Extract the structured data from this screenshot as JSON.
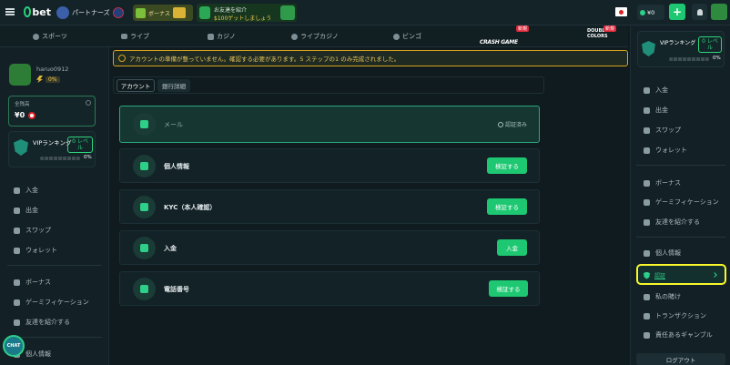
{
  "header": {
    "logo": "bet",
    "partners": "パートナーズ",
    "bonus": "ボーナス",
    "promo_line1": "お友達を紹介",
    "promo_line2": "$100ゲットしましょう",
    "balance": "¥0",
    "add": "+"
  },
  "nav": {
    "items": [
      "スポーツ",
      "ライブ",
      "カジノ",
      "ライブカジノ",
      "ビンゴ"
    ],
    "crash": "CRASH GAME",
    "double": "DOUBLE COLORS",
    "new_badge": "新規"
  },
  "user": {
    "name": "haruo0912",
    "percent": "0%"
  },
  "wallet": {
    "label": "全残高",
    "amount": "¥0"
  },
  "vip": {
    "title": "VIPランキング",
    "level": "0 レベル",
    "percent": "0%"
  },
  "left_menu": {
    "deposit": "入金",
    "withdraw": "出金",
    "swap": "スワップ",
    "wallet": "ウォレット",
    "bonus": "ボーナス",
    "gamification": "ゲーミフィケーション",
    "referral": "友達を紹介する",
    "personal": "個人情報",
    "chat": "CHAT"
  },
  "alert": "アカウントの準備が整っていません。確認する必要があります。5 ステップの1 のみ完成されました。",
  "tabs": {
    "account": "アカウント",
    "bank": "銀行詳細"
  },
  "verify": {
    "email": {
      "label": "メール",
      "status": "認証済み"
    },
    "personal": {
      "label": "個人情報",
      "button": "検証する"
    },
    "kyc": {
      "label": "KYC（本人確認）",
      "button": "検証する"
    },
    "deposit": {
      "label": "入金",
      "button": "入金"
    },
    "phone": {
      "label": "電話番号",
      "button": "検証する"
    }
  },
  "right_menu": {
    "vip_title": "VIPランキング",
    "vip_level": "0 レベル",
    "percent": "0%",
    "deposit": "入金",
    "withdraw": "出金",
    "swap": "スワップ",
    "wallet": "ウォレット",
    "bonus": "ボーナス",
    "gamification": "ゲーミフィケーション",
    "referral": "友達を紹介する",
    "personal": "個人情報",
    "security": "認証",
    "mybets": "私の賭け",
    "transactions": "トランザクション",
    "responsible": "責任あるギャンブル",
    "logout": "ログアウト"
  },
  "colors": {
    "accent": "#1ec872",
    "highlight": "#f7f72a",
    "alert": "#d8a31e"
  }
}
